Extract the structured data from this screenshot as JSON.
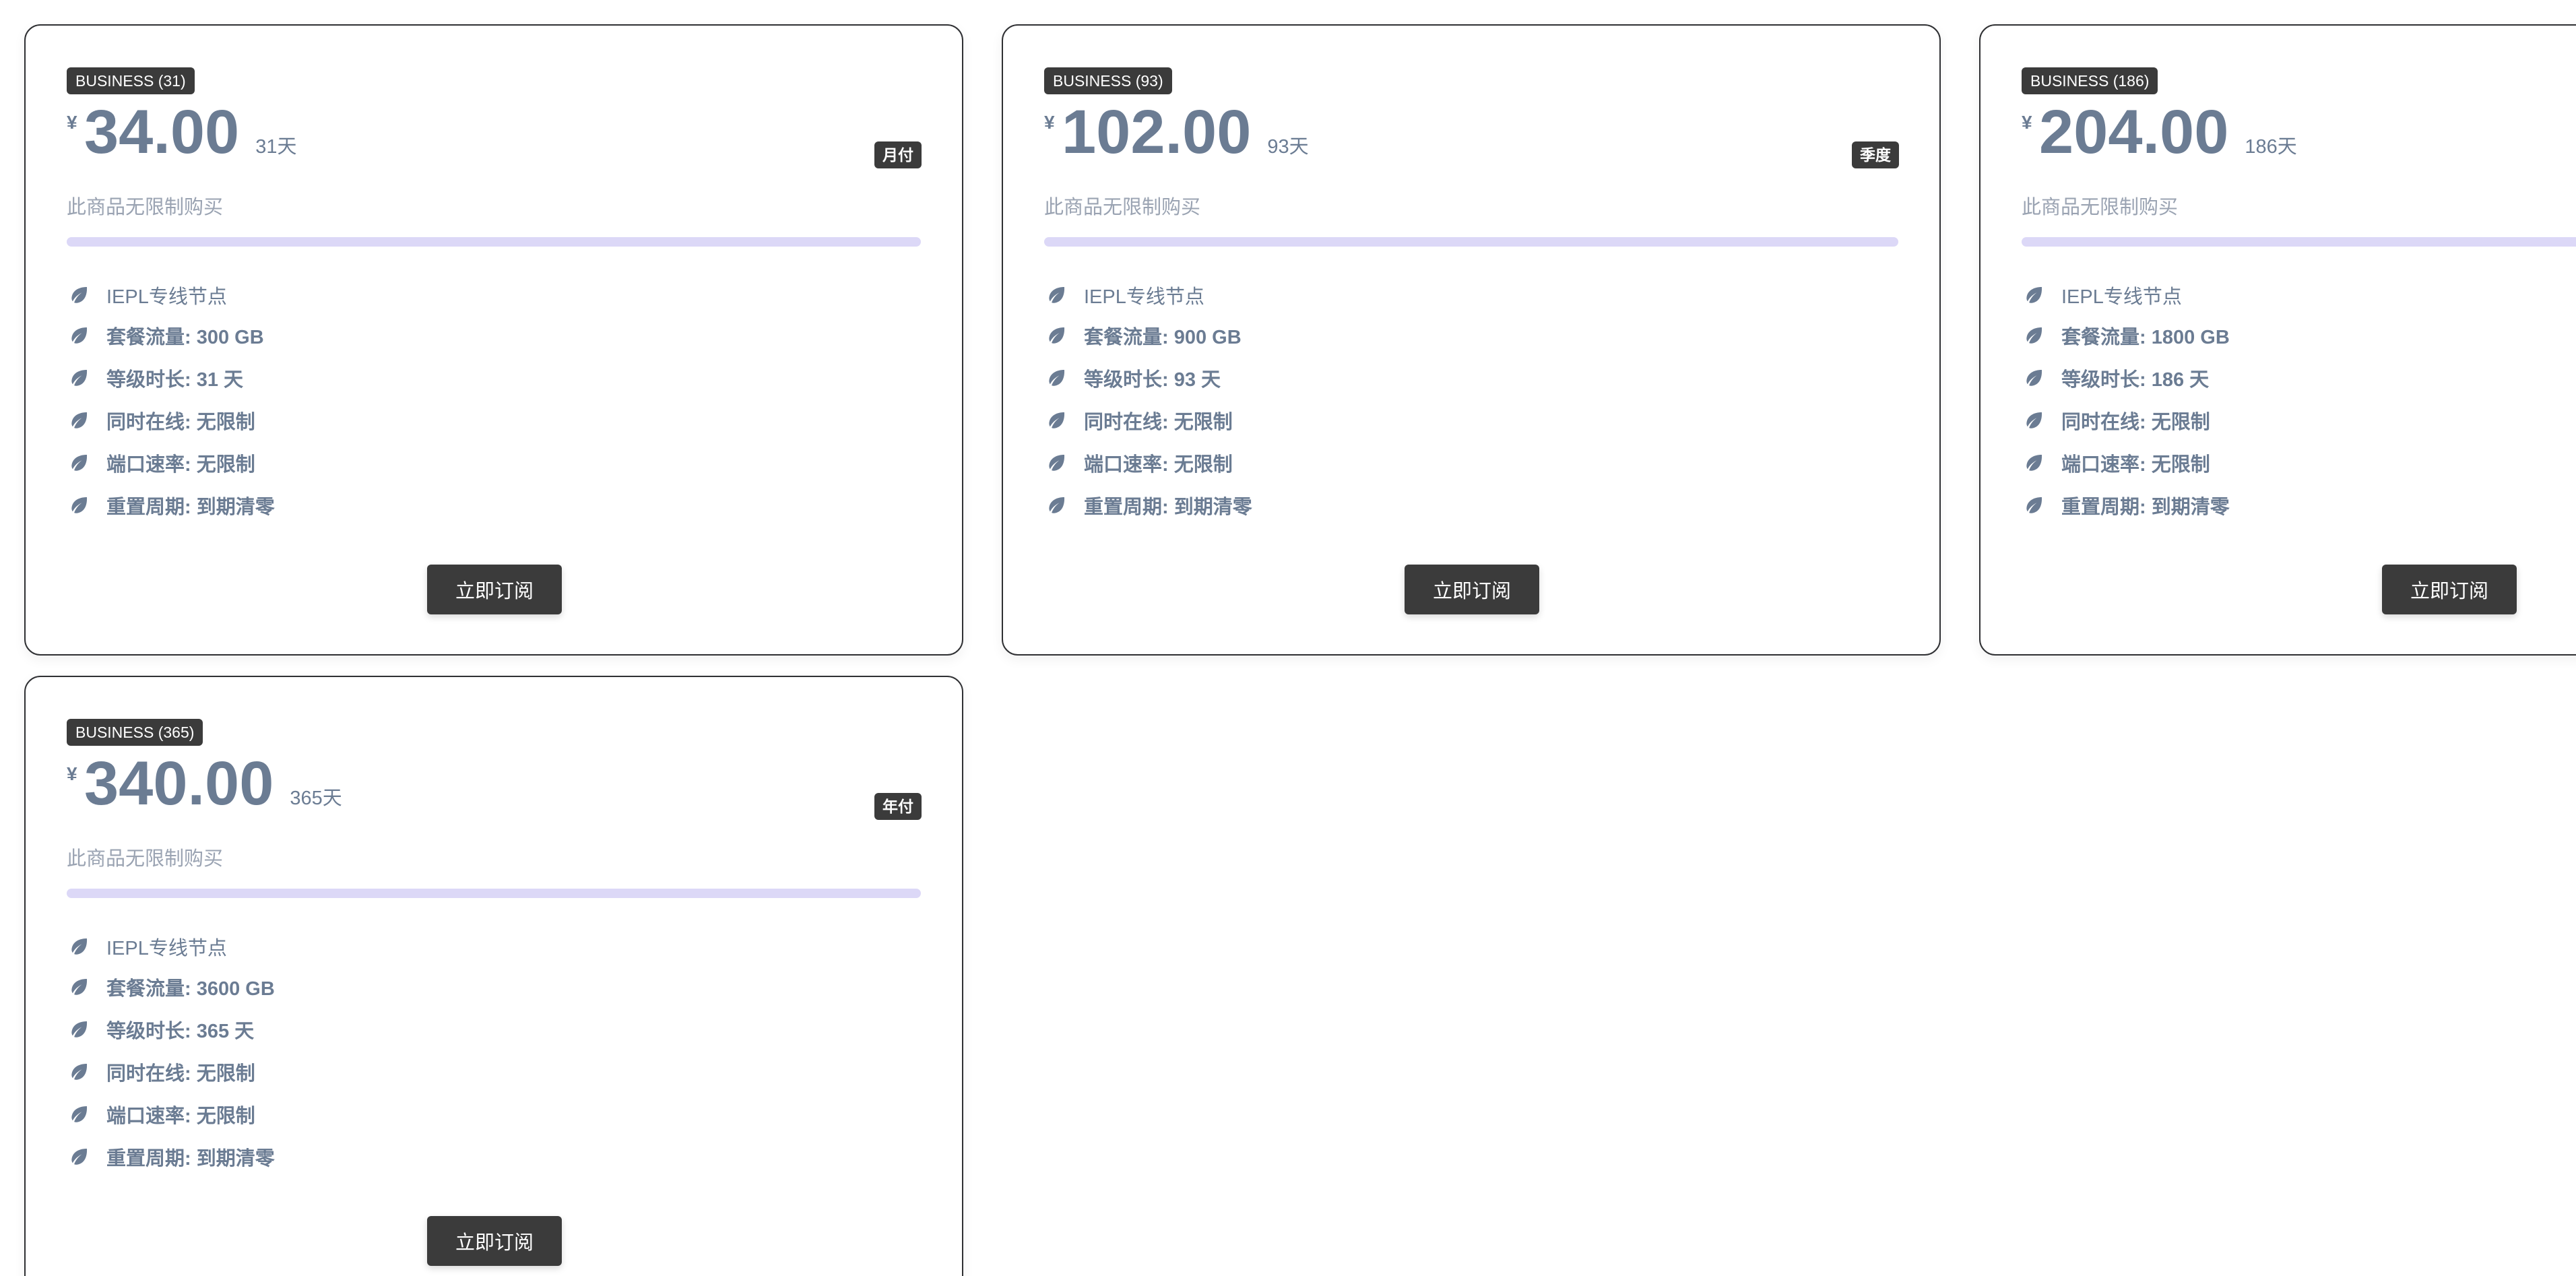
{
  "plans": [
    {
      "name": "BUSINESS (31)",
      "currency": "¥",
      "price": "34.00",
      "duration": "31天",
      "period_badge": "月付",
      "limit_text": "此商品无限制购买",
      "features": {
        "node": "IEPL专线节点",
        "traffic": "套餐流量: 300 GB",
        "level_duration": "等级时长: 31 天",
        "online": "同时在线: 无限制",
        "port_speed": "端口速率: 无限制",
        "reset_cycle": "重置周期: 到期清零"
      },
      "subscribe_label": "立即订阅"
    },
    {
      "name": "BUSINESS (93)",
      "currency": "¥",
      "price": "102.00",
      "duration": "93天",
      "period_badge": "季度",
      "limit_text": "此商品无限制购买",
      "features": {
        "node": "IEPL专线节点",
        "traffic": "套餐流量: 900 GB",
        "level_duration": "等级时长: 93 天",
        "online": "同时在线: 无限制",
        "port_speed": "端口速率: 无限制",
        "reset_cycle": "重置周期: 到期清零"
      },
      "subscribe_label": "立即订阅"
    },
    {
      "name": "BUSINESS (186)",
      "currency": "¥",
      "price": "204.00",
      "duration": "186天",
      "period_badge": "",
      "limit_text": "此商品无限制购买",
      "features": {
        "node": "IEPL专线节点",
        "traffic": "套餐流量: 1800 GB",
        "level_duration": "等级时长: 186 天",
        "online": "同时在线: 无限制",
        "port_speed": "端口速率: 无限制",
        "reset_cycle": "重置周期: 到期清零"
      },
      "subscribe_label": "立即订阅"
    },
    {
      "name": "BUSINESS (365)",
      "currency": "¥",
      "price": "340.00",
      "duration": "365天",
      "period_badge": "年付",
      "limit_text": "此商品无限制购买",
      "features": {
        "node": "IEPL专线节点",
        "traffic": "套餐流量: 3600 GB",
        "level_duration": "等级时长: 365 天",
        "online": "同时在线: 无限制",
        "port_speed": "端口速率: 无限制",
        "reset_cycle": "重置周期: 到期清零"
      },
      "subscribe_label": "立即订阅"
    }
  ],
  "icons": {
    "feature_icon": "leaf-icon"
  },
  "colors": {
    "card_border": "#2f3033",
    "tag_background": "#3b3b3b",
    "price_text": "#6b7c93",
    "muted_text": "#9aa3b2",
    "progress_track": "#eeecfb",
    "button_background": "#3b3b3b"
  }
}
